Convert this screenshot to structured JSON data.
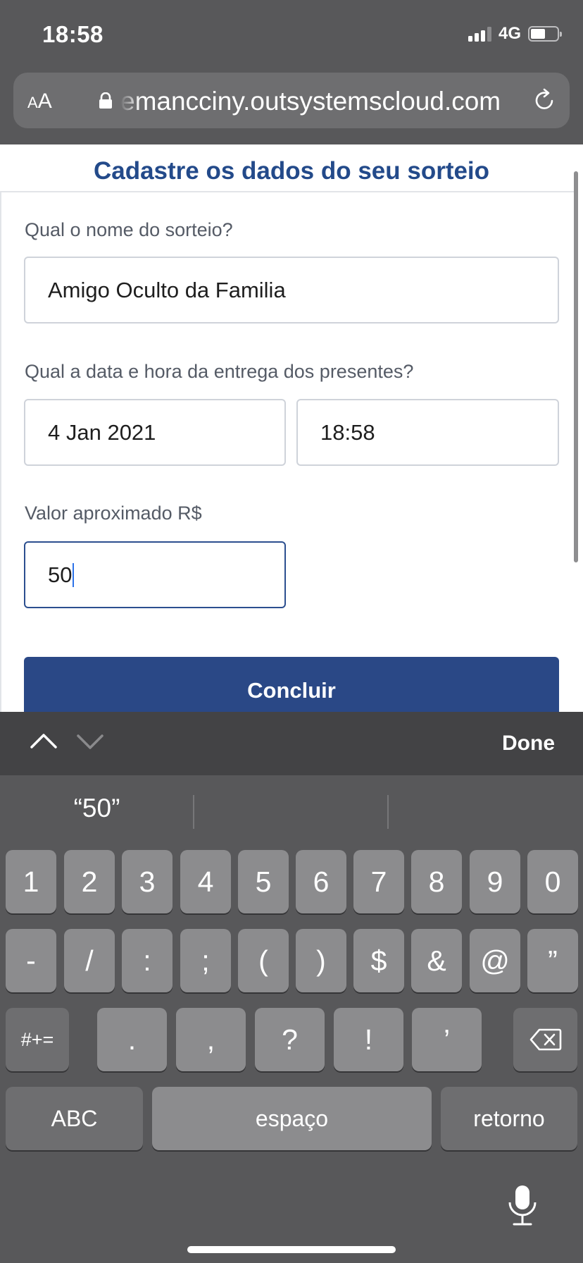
{
  "status_bar": {
    "time": "18:58",
    "network": "4G"
  },
  "browser": {
    "text_size_label_small": "A",
    "text_size_label_large": "A",
    "url": "emancciny.outsystemscloud.com"
  },
  "form": {
    "title": "Cadastre os dados do seu sorteio",
    "name_label": "Qual o nome do sorteio?",
    "name_value": "Amigo Oculto da Familia",
    "datetime_label": "Qual a data e hora da entrega dos presentes?",
    "date_value": "4 Jan 2021",
    "time_value": "18:58",
    "amount_label": "Valor aproximado R$",
    "amount_value": "50",
    "submit_label": "Concluir"
  },
  "accessory": {
    "done_label": "Done"
  },
  "keyboard": {
    "suggestions": [
      "“50”",
      "",
      ""
    ],
    "row1": [
      "1",
      "2",
      "3",
      "4",
      "5",
      "6",
      "7",
      "8",
      "9",
      "0"
    ],
    "row2": [
      "-",
      "/",
      ":",
      ";",
      "(",
      ")",
      "$",
      "&",
      "@",
      "”"
    ],
    "row3": [
      ".",
      ",",
      "?",
      "!",
      "’"
    ],
    "symbols_label": "#+=",
    "abc_label": "ABC",
    "space_label": "espaço",
    "return_label": "retorno"
  }
}
